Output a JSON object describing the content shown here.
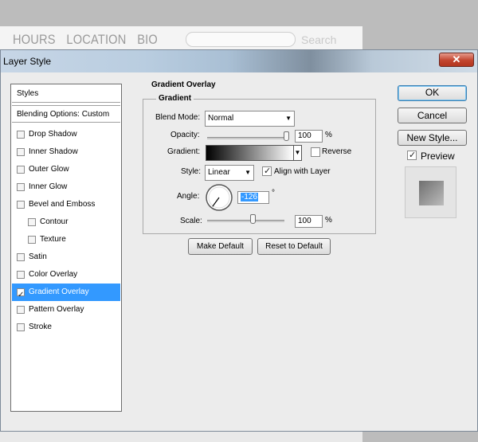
{
  "background": {
    "nav_items": [
      "HOURS",
      "LOCATION",
      "BIO"
    ],
    "search_placeholder": "Search"
  },
  "dialog": {
    "title": "Layer Style",
    "close_glyph": "✕"
  },
  "styles_list": {
    "header": "Styles",
    "blending": "Blending Options: Custom",
    "items": [
      {
        "label": "Drop Shadow",
        "checked": false
      },
      {
        "label": "Inner Shadow",
        "checked": false
      },
      {
        "label": "Outer Glow",
        "checked": false
      },
      {
        "label": "Inner Glow",
        "checked": false
      },
      {
        "label": "Bevel and Emboss",
        "checked": false
      },
      {
        "label": "Contour",
        "checked": false
      },
      {
        "label": "Texture",
        "checked": false
      },
      {
        "label": "Satin",
        "checked": false
      },
      {
        "label": "Color Overlay",
        "checked": false
      },
      {
        "label": "Gradient Overlay",
        "checked": true
      },
      {
        "label": "Pattern Overlay",
        "checked": false
      },
      {
        "label": "Stroke",
        "checked": false
      }
    ]
  },
  "panel": {
    "section_title": "Gradient Overlay",
    "group_title": "Gradient",
    "blend_mode_label": "Blend Mode:",
    "blend_mode_value": "Normal",
    "opacity_label": "Opacity:",
    "opacity_value": "100",
    "opacity_unit": "%",
    "opacity_level": 1.0,
    "gradient_label": "Gradient:",
    "reverse_label": "Reverse",
    "reverse_checked": false,
    "style_label": "Style:",
    "style_value": "Linear",
    "align_label": "Align with Layer",
    "align_checked": true,
    "angle_label": "Angle:",
    "angle_value": "-126",
    "angle_unit": "°",
    "scale_label": "Scale:",
    "scale_value": "100",
    "scale_unit": "%",
    "scale_level": 0.6,
    "make_default": "Make Default",
    "reset_default": "Reset to Default"
  },
  "right": {
    "ok": "OK",
    "cancel": "Cancel",
    "new_style": "New Style...",
    "preview_label": "Preview",
    "preview_checked": true
  }
}
